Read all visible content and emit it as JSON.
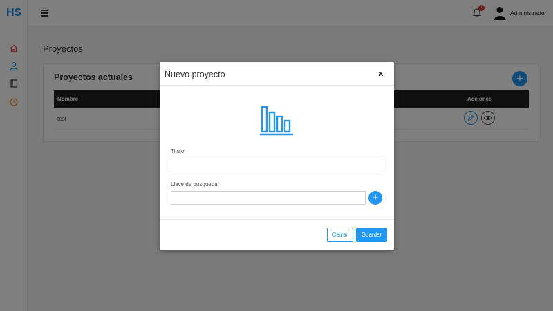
{
  "app": {
    "logo": "HS",
    "brand_color": "#1e88e5"
  },
  "sidebar": {
    "items": [
      {
        "name": "home-icon",
        "color": "#e53935"
      },
      {
        "name": "user-icon",
        "color": "#1e88e5"
      },
      {
        "name": "book-icon",
        "color": "#333333"
      },
      {
        "name": "clock-icon",
        "color": "#fb8c00"
      }
    ]
  },
  "header": {
    "menu_icon": "hamburger-icon",
    "notifications_count": "1",
    "username": "Administrador"
  },
  "main": {
    "page_title": "Proyectos",
    "card_title": "Proyectos actuales",
    "table": {
      "columns": [
        "Nombre",
        "Acciones"
      ],
      "rows": [
        {
          "name": "test"
        }
      ]
    }
  },
  "modal": {
    "title": "Nuevo proyecto",
    "close_label": "x",
    "fields": {
      "titulo": {
        "label": "Titulo",
        "value": ""
      },
      "llave": {
        "label": "Llave de busqueda",
        "value": ""
      }
    },
    "buttons": {
      "cancel": "Cerrar",
      "save": "Guardar"
    }
  },
  "colors": {
    "accent": "#2196f3",
    "header_row": "#212121"
  }
}
